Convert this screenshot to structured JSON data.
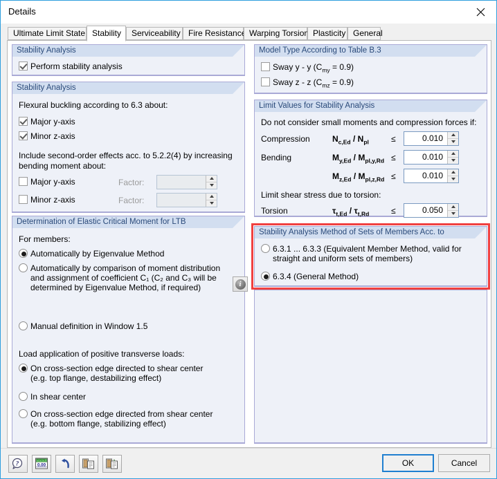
{
  "window": {
    "title": "Details",
    "close_icon": "close-icon"
  },
  "tabs": [
    {
      "label": "Ultimate Limit State",
      "active": false
    },
    {
      "label": "Stability",
      "active": true
    },
    {
      "label": "Serviceability",
      "active": false
    },
    {
      "label": "Fire Resistance",
      "active": false
    },
    {
      "label": "Warping Torsion",
      "active": false
    },
    {
      "label": "Plasticity",
      "active": false
    },
    {
      "label": "General",
      "active": false
    }
  ],
  "left": {
    "group_perform": {
      "title": "Stability Analysis",
      "checkbox": {
        "label": "Perform stability analysis",
        "checked": true
      }
    },
    "group_flexural": {
      "title": "Stability Analysis",
      "heading": "Flexural buckling according to 6.3 about:",
      "items": [
        {
          "label": "Major y-axis",
          "checked": true
        },
        {
          "label": "Minor z-axis",
          "checked": true
        }
      ],
      "second_order_heading": "Include second-order effects acc. to 5.2.2(4) by increasing bending moment about:",
      "second_order": [
        {
          "label": "Major y-axis",
          "checked": false,
          "factor_label": "Factor:",
          "factor_value": ""
        },
        {
          "label": "Minor z-axis",
          "checked": false,
          "factor_label": "Factor:",
          "factor_value": ""
        }
      ]
    },
    "group_ltb": {
      "title": "Determination of Elastic Critical Moment for LTB",
      "for_members_label": "For members:",
      "options": [
        {
          "label": "Automatically by Eigenvalue Method",
          "selected": true
        },
        {
          "label": "Automatically by comparison of moment distribution and assignment of coefficient C₁ (C₂ and C₃ will be determined by Eigenvalue Method, if required)",
          "selected": false
        },
        {
          "label": "Manual definition in Window 1.5",
          "selected": false
        }
      ],
      "info_button_icon": "info-icon",
      "load_heading": "Load application of positive transverse loads:",
      "load_options": [
        {
          "label": "On cross-section edge directed to shear center (e.g. top flange, destabilizing effect)",
          "selected": true
        },
        {
          "label": "In shear center",
          "selected": false
        },
        {
          "label": "On cross-section edge directed from shear center (e.g. bottom flange, stabilizing effect)",
          "selected": false
        }
      ]
    }
  },
  "right": {
    "group_model_type": {
      "title": "Model Type According to Table B.3",
      "items": [
        {
          "label": "Sway y - y (C",
          "sub": "my",
          "tail": " = 0.9)",
          "checked": false
        },
        {
          "label": "Sway z - z (C",
          "sub": "mz",
          "tail": " = 0.9)",
          "checked": false
        }
      ]
    },
    "group_limits": {
      "title": "Limit Values for Stability Analysis",
      "heading": "Do not consider small moments and compression forces if:",
      "rows": [
        {
          "name": "Compression",
          "formula_num": "N",
          "formula_num_sub": "c,Ed",
          "formula_den": "N",
          "formula_den_sub": "pl",
          "op": "≤",
          "value": "0.010"
        },
        {
          "name": "Bending",
          "formula_num": "M",
          "formula_num_sub": "y,Ed",
          "formula_den": "M",
          "formula_den_sub": "pl,y,Rd",
          "op": "≤",
          "value": "0.010"
        },
        {
          "name": "",
          "formula_num": "M",
          "formula_num_sub": "z,Ed",
          "formula_den": "M",
          "formula_den_sub": "pl,z,Rd",
          "op": "≤",
          "value": "0.010"
        }
      ],
      "torsion_heading": "Limit shear stress due to torsion:",
      "torsion_row": {
        "name": "Torsion",
        "formula_num": "τ",
        "formula_num_sub": "t,Ed",
        "formula_den": "τ",
        "formula_den_sub": "t,Rd",
        "op": "≤",
        "value": "0.050"
      }
    },
    "group_sets": {
      "title": "Stability Analysis Method of Sets of Members Acc. to",
      "highlight_color": "#f04040",
      "options": [
        {
          "label": "6.3.1 ... 6.3.3 (Equivalent Member Method, valid for straight and uniform sets of members)",
          "selected": false
        },
        {
          "label": "6.3.4  (General Method)",
          "selected": true
        }
      ]
    }
  },
  "bottom": {
    "toolbar": [
      {
        "name": "help-icon",
        "glyph": "?"
      },
      {
        "name": "units-icon",
        "glyph": "0.00"
      },
      {
        "name": "undo-icon",
        "glyph": "↷"
      },
      {
        "name": "copy-icon",
        "glyph": "⧉"
      },
      {
        "name": "paste-icon",
        "glyph": "⧉"
      }
    ],
    "ok_label": "OK",
    "cancel_label": "Cancel"
  }
}
